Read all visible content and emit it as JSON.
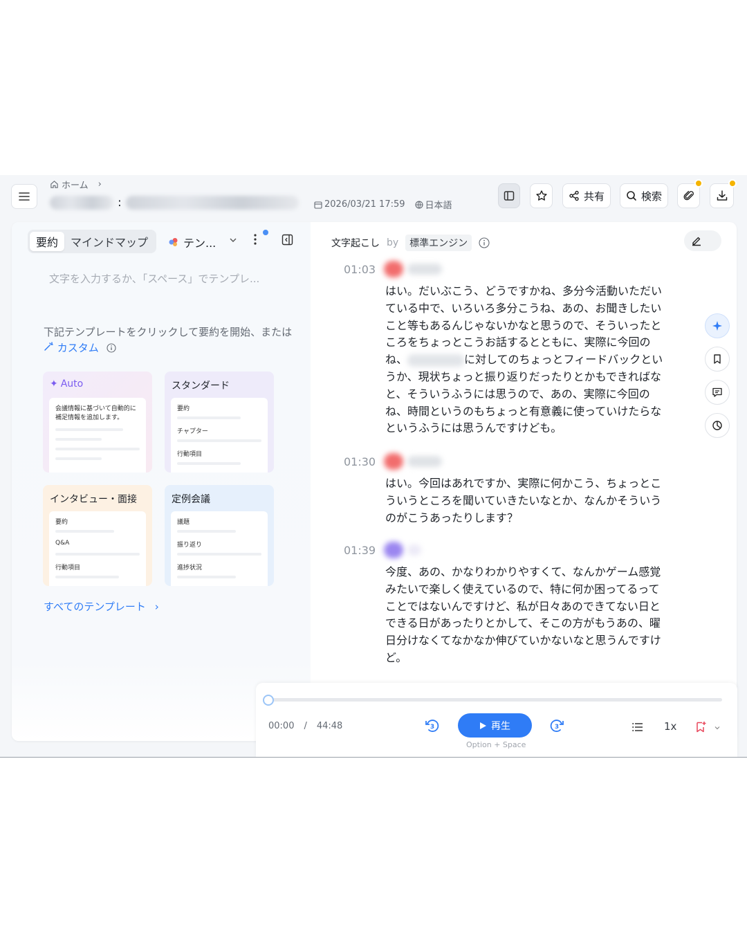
{
  "breadcrumb": {
    "home": "ホーム"
  },
  "header": {
    "title_separator": ":",
    "date": "2026/03/21 17:59",
    "language": "日本語",
    "share_label": "共有",
    "search_label": "検索",
    "badge_color": "#f5b400"
  },
  "left": {
    "tabs": [
      "要約",
      "マインドマップ"
    ],
    "template_label": "テン...",
    "placeholder": "文字を入力するか、「スペース」でテンプレ...",
    "hint_prefix": "下記テンプレートをクリックして要約を開始、または",
    "custom_label": "カスタム",
    "cards": [
      {
        "title": "Auto",
        "lines": [
          "会議情報に基づいて自動的に",
          "補足情報を追加します。"
        ]
      },
      {
        "title": "スタンダード",
        "items": [
          "要約",
          "チャプター",
          "行動項目"
        ]
      },
      {
        "title": "インタビュー・面接",
        "items": [
          "要約",
          "Q&A",
          "行動項目"
        ]
      },
      {
        "title": "定例会議",
        "items": [
          "議題",
          "振り返り",
          "進捗状況"
        ]
      }
    ],
    "all_templates": "すべてのテンプレート"
  },
  "transcript": {
    "header": "文字起こし",
    "by": "by",
    "engine": "標準エンジン",
    "segments": [
      {
        "time": "01:03",
        "text_before": "はい。だいぶこう、どうですかね、多分今活動いただいている中で、いろいろ多分こうね、あの、お聞きしたいこと等もあるんじゃないかなと思うので、そういったところをちょっとこうお話するとともに、実際に今回のね、",
        "text_after": "に対してのちょっとフィードバックというか、現状ちょっと振り返りだったりとかもできればなと、そういうふうには思うので、あの、実際に今回のね、時間というのもちょっと有意義に使っていけたらなというふうには思うんですけども。"
      },
      {
        "time": "01:30",
        "text_before": "はい。今回はあれですか、実際に何かこう、ちょっとこういうところを聞いていきたいなとか、なんかそういうのがこうあったりします？"
      },
      {
        "time": "01:39",
        "text_before": "今度、あの、かなりわかりやすくて、なんかゲーム感覚みたいで楽しく使えているので、特に何か困ってるってことではないんですけど、私が日々あのできてない日とできる日があったりとかして、そこの方がもうあの、曜日分けなくてなかなか伸びていかないなと思うんですけど。"
      }
    ]
  },
  "player": {
    "current": "00:00",
    "divider": "/",
    "total": "44:48",
    "play_label": "再生",
    "shortcut": "Option + Space",
    "skip_back": "3",
    "skip_forward": "3",
    "speed": "1x",
    "progress": 0
  }
}
